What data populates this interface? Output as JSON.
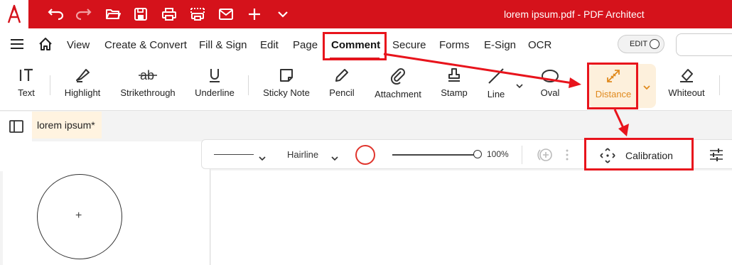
{
  "titlebar": {
    "document_title": "lorem ipsum.pdf  -  PDF Architect",
    "buttons": [
      "undo-icon",
      "redo-icon",
      "open-folder-icon",
      "save-icon",
      "print-icon",
      "scan-print-icon",
      "email-icon",
      "plus-icon",
      "chevron-down-icon"
    ]
  },
  "menubar": {
    "items": [
      {
        "label": "View"
      },
      {
        "label": "Create & Convert"
      },
      {
        "label": "Fill & Sign"
      },
      {
        "label": "Edit"
      },
      {
        "label": "Page"
      },
      {
        "label": "Comment"
      },
      {
        "label": "Secure"
      },
      {
        "label": "Forms"
      },
      {
        "label": "E-Sign"
      },
      {
        "label": "OCR"
      }
    ],
    "active": "Comment",
    "edit_toggle_label": "EDIT"
  },
  "ribbon": {
    "tools": [
      {
        "label": "Text"
      },
      {
        "label": "Highlight"
      },
      {
        "label": "Strikethrough"
      },
      {
        "label": "Underline"
      },
      {
        "label": "Sticky Note"
      },
      {
        "label": "Pencil"
      },
      {
        "label": "Attachment"
      },
      {
        "label": "Stamp"
      },
      {
        "label": "Line"
      },
      {
        "label": "Oval"
      },
      {
        "label": "Distance"
      },
      {
        "label": "Whiteout"
      }
    ],
    "selected": "Distance",
    "selected_color": "#e08a1e"
  },
  "document_tab": {
    "label": "lorem ipsum",
    "modified_marker": "*"
  },
  "properties_toolbar": {
    "line_style": "",
    "line_weight": "Hairline",
    "stroke_color": "#e0342c",
    "opacity": "100%",
    "calibration_label": "Calibration"
  },
  "colors": {
    "brand_red": "#d5121b",
    "highlight_red": "#e8141c"
  }
}
